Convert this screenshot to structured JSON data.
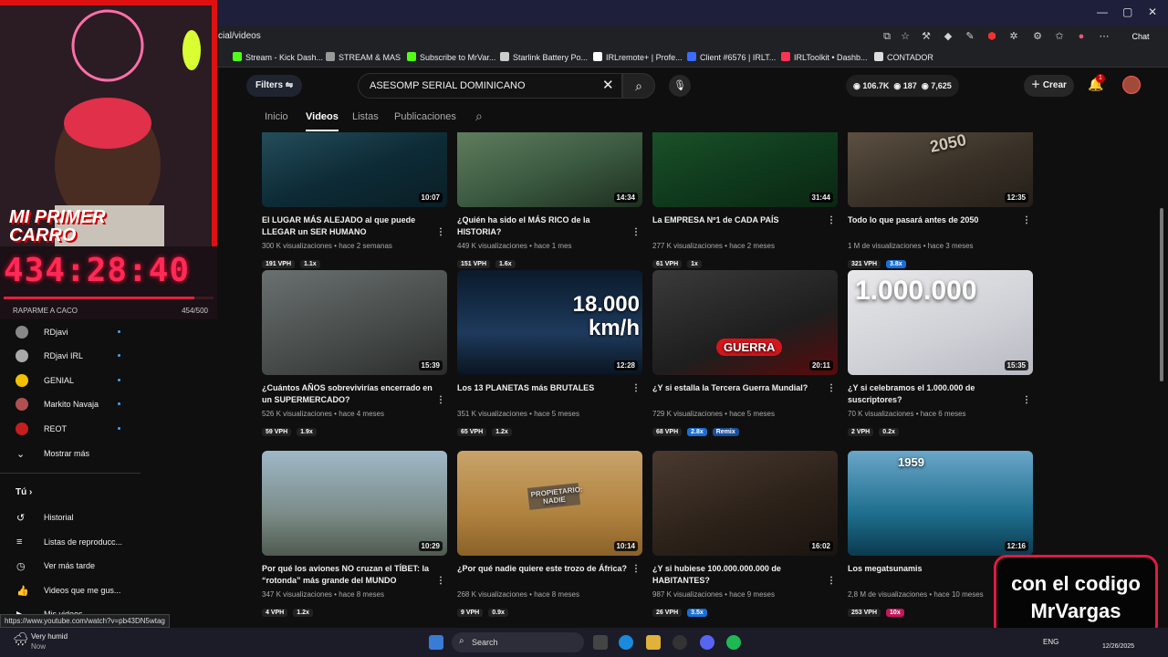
{
  "browser": {
    "url": "cial/videos",
    "bookmarks": [
      {
        "label": "Stream - Kick Dash...",
        "color": "#53fc18"
      },
      {
        "label": "STREAM & MAS",
        "color": "#999999"
      },
      {
        "label": "Subscribe to MrVar...",
        "color": "#53fc18"
      },
      {
        "label": "Starlink Battery Po...",
        "color": "#cccccc"
      },
      {
        "label": "IRLremote+ | Profe...",
        "color": "#ffffff"
      },
      {
        "label": "Client #6576 | IRLT...",
        "color": "#3b6cff"
      },
      {
        "label": "IRLToolkit • Dashb...",
        "color": "#ff3355"
      },
      {
        "label": "CONTADOR",
        "color": "#dddddd"
      }
    ],
    "chat_label": "Chat"
  },
  "header": {
    "filters_label": "Filters",
    "search_value": "ASESOMP SERIAL DOMINICANO",
    "stats": [
      "106.7K",
      "187",
      "7,625"
    ],
    "create_label": "Crear",
    "notif_count": "1"
  },
  "tabs": [
    "Inicio",
    "Videos",
    "Listas",
    "Publicaciones"
  ],
  "videos": [
    {
      "title": "El LUGAR MÁS ALEJADO al que puede LLEGAR un SER HUMANO",
      "views": "300 K visualizaciones",
      "ago": "hace 2 semanas",
      "duration": "10:07",
      "vph": "191 VPH",
      "mult": "1.1x",
      "mult_color": "#222222",
      "bg": "linear-gradient(160deg,#2d5b6a,#0d2b36 60%,#0a1e25)",
      "overlay": ""
    },
    {
      "title": "¿Quién ha sido el MÁS RICO de la HISTORIA?",
      "views": "449 K visualizaciones",
      "ago": "hace 1 mes",
      "duration": "14:34",
      "vph": "151 VPH",
      "mult": "1.6x",
      "mult_color": "#222222",
      "bg": "linear-gradient(160deg,#6f8a6a,#3b5a40 60%,#1e2e20)",
      "overlay": ""
    },
    {
      "title": "La EMPRESA Nº1 de CADA PAÍS",
      "views": "277 K visualizaciones",
      "ago": "hace 2 meses",
      "duration": "31:44",
      "vph": "61 VPH",
      "mult": "1x",
      "mult_color": "#222222",
      "bg": "linear-gradient(160deg,#1f5a2e,#0f3a1c 60%,#0a2612)",
      "overlay": ""
    },
    {
      "title": "Todo lo que pasará antes de 2050",
      "views": "1 M de visualizaciones",
      "ago": "hace 3 meses",
      "duration": "12:35",
      "vph": "321 VPH",
      "mult": "3.8x",
      "mult_color": "#1a6fd6",
      "bg": "linear-gradient(160deg,#6a5c4c,#3a3228 60%,#231e18)",
      "overlay": "2050"
    },
    {
      "title": "¿Cuántos AÑOS sobrevivirías encerrado en un SUPERMERCADO?",
      "views": "526 K visualizaciones",
      "ago": "hace 4 meses",
      "duration": "15:39",
      "vph": "59 VPH",
      "mult": "1.9x",
      "mult_color": "#222222",
      "bg": "linear-gradient(160deg,#6a7070,#454a48 60%,#2a2c2a)",
      "overlay": ""
    },
    {
      "title": "Los 13 PLANETAS más BRUTALES",
      "views": "351 K visualizaciones",
      "ago": "hace 5 meses",
      "duration": "12:28",
      "vph": "65 VPH",
      "mult": "1.2x",
      "mult_color": "#222222",
      "bg": "linear-gradient(180deg,#0b1a2c,#1d3a5c 60%,#0a1420)",
      "overlay": "18.000 km/h"
    },
    {
      "title": "¿Y si estalla la Tercera Guerra Mundial?",
      "views": "729 K visualizaciones",
      "ago": "hace 5 meses",
      "duration": "20:11",
      "vph": "68 VPH",
      "mult": "2.8x",
      "mult_color": "#1a6fd6",
      "extra": "Remix",
      "bg": "linear-gradient(160deg,#3a3a3a,#1e1e1e 60%,#5a0a0a)",
      "overlay": "GUERRA"
    },
    {
      "title": "¿Y si celebramos el 1.000.000 de suscriptores?",
      "views": "70 K visualizaciones",
      "ago": "hace 6 meses",
      "duration": "15:35",
      "vph": "2 VPH",
      "mult": "0.2x",
      "mult_color": "#222222",
      "bg": "linear-gradient(160deg,#e8e8ea,#cfd0d6 60%,#b8b9c2)",
      "overlay": "1.000.000"
    },
    {
      "title": "Por qué los aviones NO cruzan el TÍBET: la “rotonda” más grande del MUNDO",
      "views": "347 K visualizaciones",
      "ago": "hace 8 meses",
      "duration": "10:29",
      "vph": "4 VPH",
      "mult": "1.2x",
      "mult_color": "#222222",
      "bg": "linear-gradient(180deg,#9fb8c8,#7b8c88 60%,#4f5a50)",
      "overlay": ""
    },
    {
      "title": "¿Por qué nadie quiere este trozo de África?",
      "views": "268 K visualizaciones",
      "ago": "hace 8 meses",
      "duration": "10:14",
      "vph": "9 VPH",
      "mult": "0.9x",
      "mult_color": "#222222",
      "bg": "linear-gradient(180deg,#c9a36a,#b0823f 60%,#8a6128)",
      "overlay": "PROPIETARIO: NADIE"
    },
    {
      "title": "¿Y si hubiese 100.000.000.000 de HABITANTES?",
      "views": "987 K visualizaciones",
      "ago": "hace 9 meses",
      "duration": "16:02",
      "vph": "26 VPH",
      "mult": "3.5x",
      "mult_color": "#1a6fd6",
      "bg": "linear-gradient(160deg,#4a3a30,#2a2018 60%,#1a140f)",
      "overlay": ""
    },
    {
      "title": "Los megatsunamis",
      "views": "2,8 M de visualizaciones",
      "ago": "hace 10 meses",
      "duration": "12:16",
      "vph": "253 VPH",
      "mult": "10x",
      "mult_color": "#c2185b",
      "bg": "linear-gradient(180deg,#6aa6c8,#1e6e8e 60%,#0b3a4e)",
      "overlay": "1959"
    }
  ],
  "stream": {
    "overlay_title": "MI PRIMER CARRO",
    "timer": "434:28:40",
    "goal_label": "RAPARME A CACO",
    "goal_count": "454/500",
    "goal_fraction": 0.908
  },
  "sidebar": {
    "subs": [
      {
        "name": "RDjavi",
        "color": "#888888"
      },
      {
        "name": "RDjavi IRL",
        "color": "#aaaaaa"
      },
      {
        "name": "GENIAL",
        "color": "#f2c200"
      },
      {
        "name": "Markito Navaja",
        "color": "#b05050"
      },
      {
        "name": "REOT",
        "color": "#c41e1e"
      }
    ],
    "show_more": "Mostrar más",
    "you": "Tú",
    "you_items": [
      "Historial",
      "Listas de reproducc...",
      "Ver más tarde",
      "Videos que me gus..."
    ],
    "cut_item": "Mis videos"
  },
  "promo": {
    "line1": "con el codigo",
    "line2": "MrVargas"
  },
  "status_url": "https://www.youtube.com/watch?v=pb43DN5wtag",
  "taskbar": {
    "weather": "Very humid",
    "weather_sub": "Now",
    "search": "Search",
    "lang": "ENG",
    "date": "12/26/2025"
  }
}
